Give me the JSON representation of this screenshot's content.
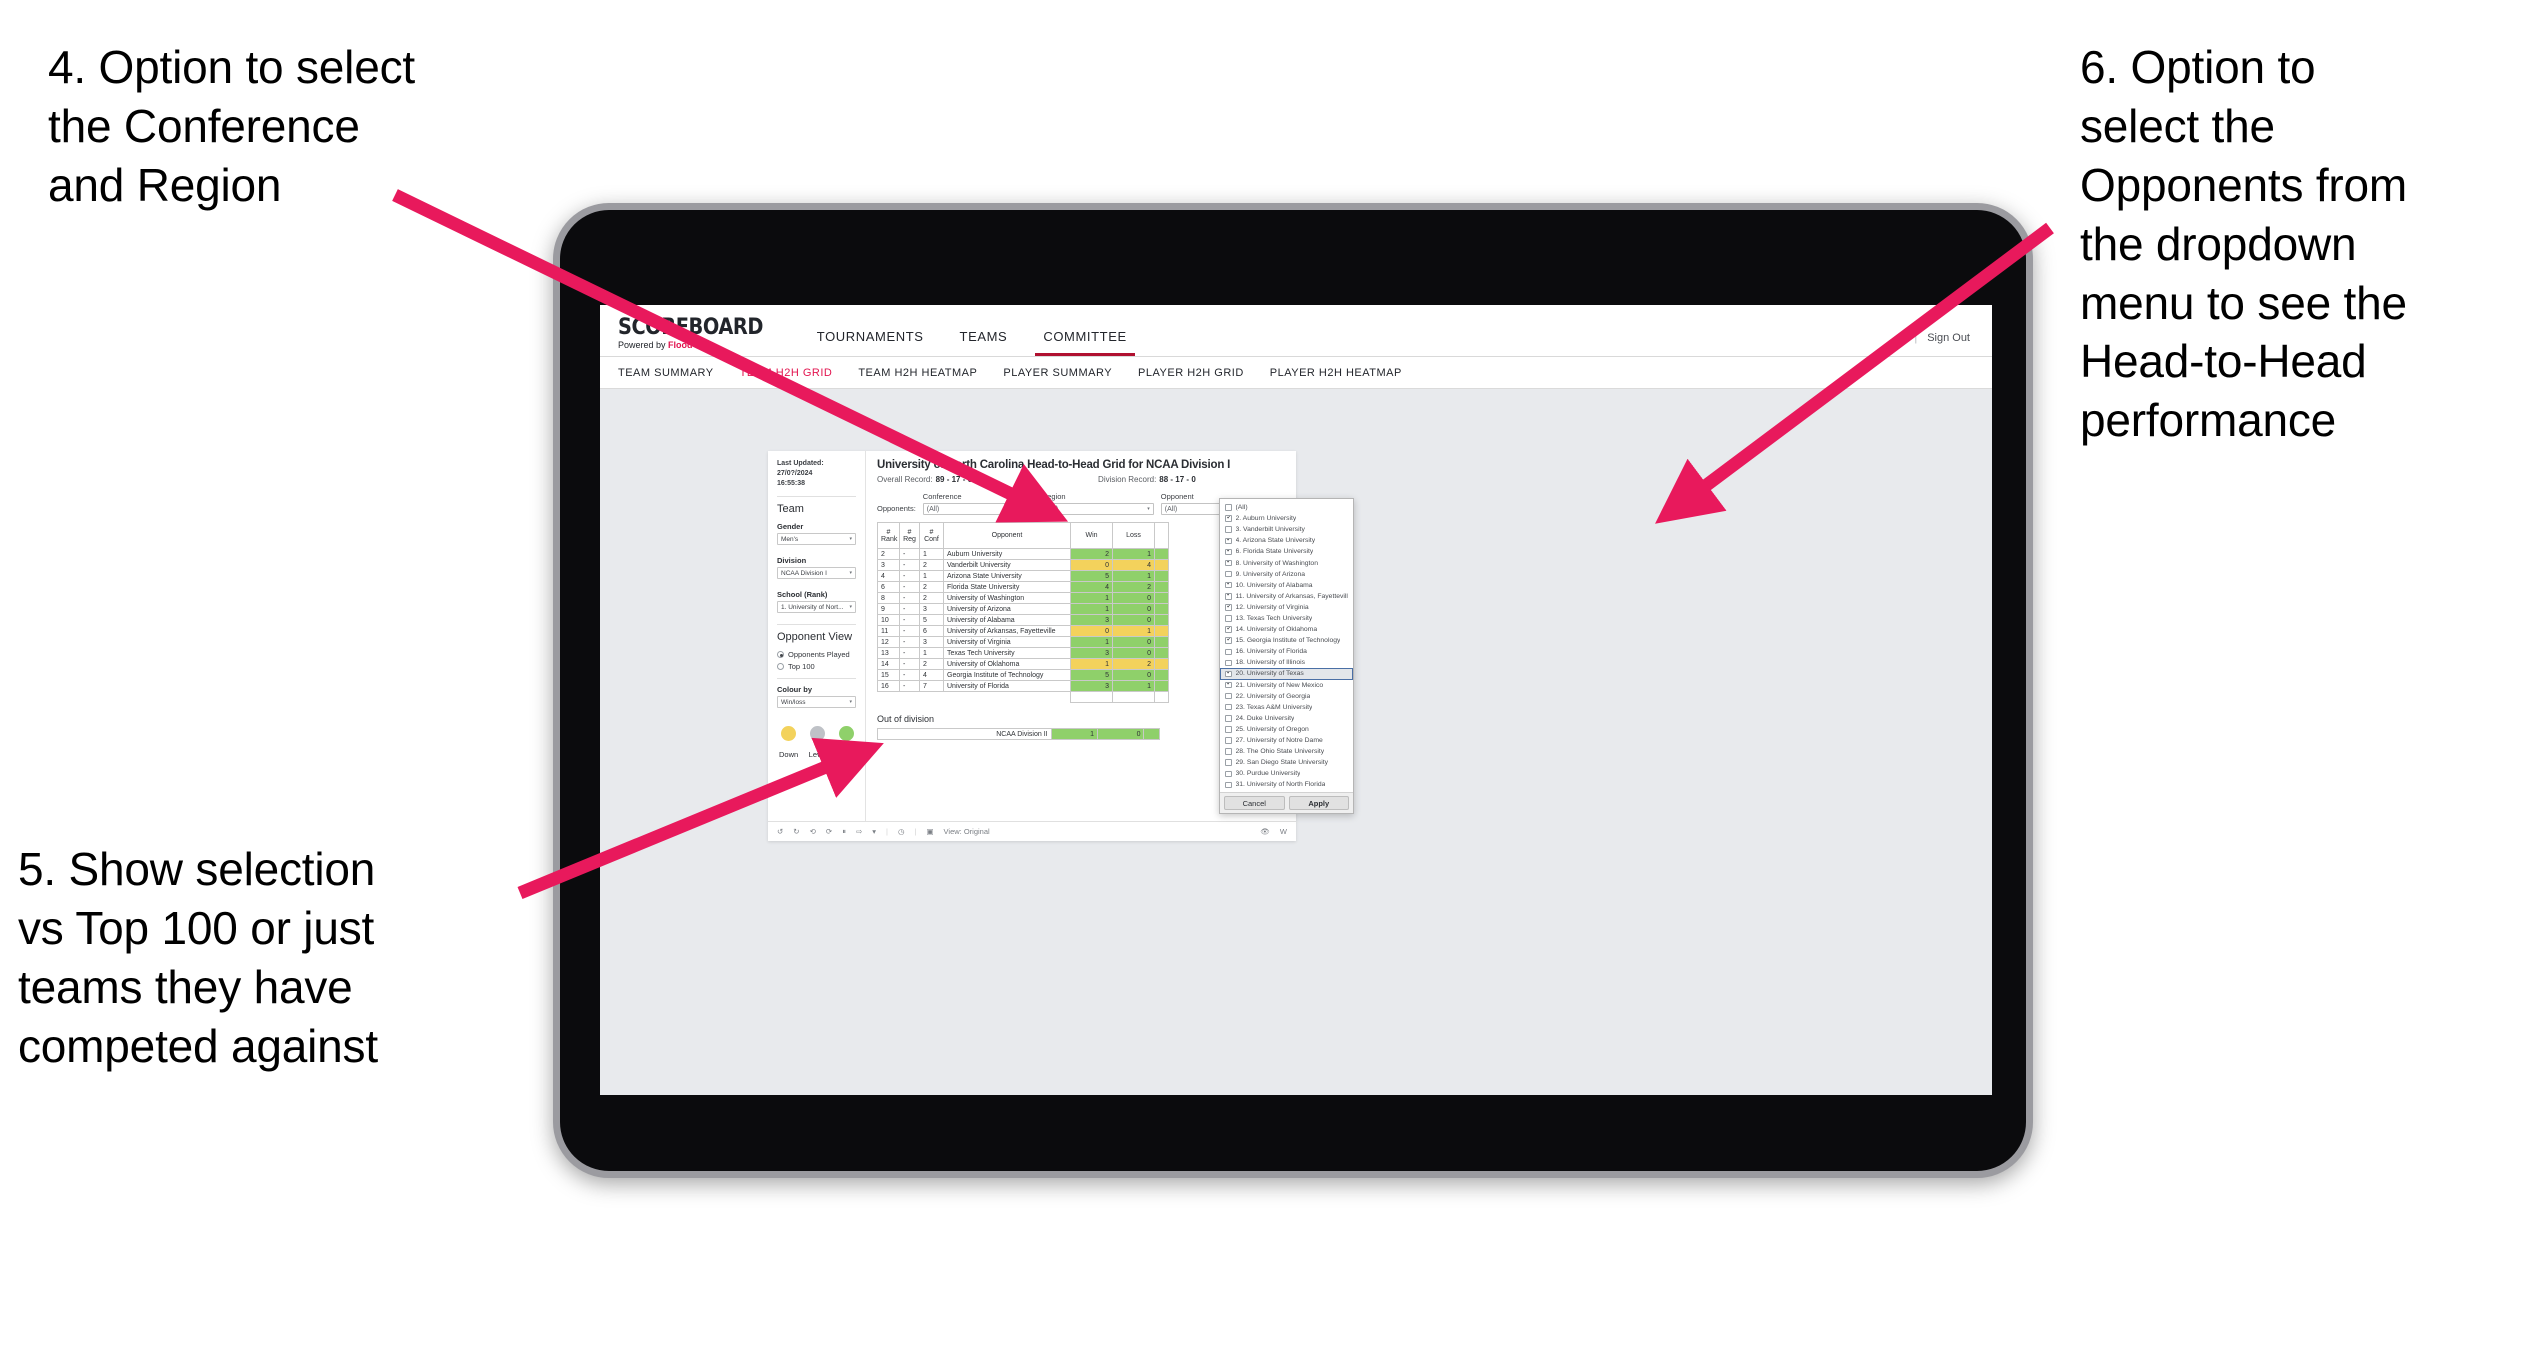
{
  "annotations": [
    {
      "id": "a4",
      "text": "4. Option to select\nthe Conference\nand Region"
    },
    {
      "id": "a5",
      "text": "5. Show selection\nvs Top 100 or just\nteams they have\ncompeted against"
    },
    {
      "id": "a6",
      "text": "6. Option to\nselect the\nOpponents from\nthe dropdown\nmenu to see the\nHead-to-Head\nperformance"
    }
  ],
  "accent_color": "#e8195c",
  "header": {
    "brand_name": "SCOREBOARD",
    "brand_sub_prefix": "Powered by ",
    "brand_sub_accent": "Flood",
    "nav": [
      {
        "label": "TOURNAMENTS",
        "active": false
      },
      {
        "label": "TEAMS",
        "active": false
      },
      {
        "label": "COMMITTEE",
        "active": true
      }
    ],
    "separator": "|",
    "sign_out": "Sign Out"
  },
  "subnav": [
    {
      "label": "TEAM SUMMARY",
      "active": false
    },
    {
      "label": "TEAM H2H GRID",
      "active": true
    },
    {
      "label": "TEAM H2H HEATMAP",
      "active": false
    },
    {
      "label": "PLAYER SUMMARY",
      "active": false
    },
    {
      "label": "PLAYER H2H GRID",
      "active": false
    },
    {
      "label": "PLAYER H2H HEATMAP",
      "active": false
    }
  ],
  "panel": {
    "updated_line1": "Last Updated: 27/0?/2024",
    "updated_line2": "16:55:38",
    "team_heading": "Team",
    "gender_label": "Gender",
    "gender_value": "Men's",
    "division_label": "Division",
    "division_value": "NCAA Division I",
    "school_label": "School (Rank)",
    "school_value": "1. University of Nort...",
    "opponent_view_heading": "Opponent View",
    "opponent_view_options": [
      {
        "label": "Opponents Played",
        "selected": true
      },
      {
        "label": "Top 100",
        "selected": false
      }
    ],
    "colour_by_label": "Colour by",
    "colour_by_value": "Win/loss",
    "legend": [
      {
        "label": "Down",
        "color": "#f3d25c"
      },
      {
        "label": "Level",
        "color": "#bfc2c7"
      },
      {
        "label": "Up",
        "color": "#8fd06a"
      }
    ]
  },
  "viz": {
    "title": "University of North Carolina Head-to-Head Grid for NCAA Division I",
    "overall_record_label": "Overall Record:",
    "overall_record_value": "89 - 17 - 0",
    "division_record_label": "Division Record:",
    "division_record_value": "88 - 17 - 0",
    "opponents_lead": "Opponents:",
    "filters": [
      {
        "label": "Conference",
        "value": "(All)"
      },
      {
        "label": "Region",
        "value": "(All)"
      },
      {
        "label": "Opponent",
        "value": "(All)"
      }
    ],
    "out_of_division_title": "Out of division",
    "out_of_division_row": {
      "label": "NCAA Division II",
      "win": "1",
      "loss": "0",
      "state": "up"
    }
  },
  "chart_data": {
    "type": "table",
    "title": "University of North Carolina Head-to-Head Grid for NCAA Division I",
    "columns": [
      "# Rank",
      "# Reg",
      "# Conf",
      "Opponent",
      "Win",
      "Loss"
    ],
    "column_headers_multiline": [
      {
        "l1": "#",
        "l2": "Rank"
      },
      {
        "l1": "#",
        "l2": "Reg"
      },
      {
        "l1": "#",
        "l2": "Conf"
      },
      {
        "l1": "",
        "l2": "Opponent"
      },
      {
        "l1": "",
        "l2": "Win"
      },
      {
        "l1": "",
        "l2": "Loss"
      }
    ],
    "color_legend": {
      "up": "#8fd06a",
      "down": "#f3d25c",
      "level": "#bfc2c7"
    },
    "rows": [
      {
        "rank": "2",
        "reg": "-",
        "conf": "1",
        "opponent": "Auburn University",
        "win": "2",
        "loss": "1",
        "state": "up"
      },
      {
        "rank": "3",
        "reg": "-",
        "conf": "2",
        "opponent": "Vanderbilt University",
        "win": "0",
        "loss": "4",
        "state": "down"
      },
      {
        "rank": "4",
        "reg": "-",
        "conf": "1",
        "opponent": "Arizona State University",
        "win": "5",
        "loss": "1",
        "state": "up"
      },
      {
        "rank": "6",
        "reg": "-",
        "conf": "2",
        "opponent": "Florida State University",
        "win": "4",
        "loss": "2",
        "state": "up"
      },
      {
        "rank": "8",
        "reg": "-",
        "conf": "2",
        "opponent": "University of Washington",
        "win": "1",
        "loss": "0",
        "state": "up"
      },
      {
        "rank": "9",
        "reg": "-",
        "conf": "3",
        "opponent": "University of Arizona",
        "win": "1",
        "loss": "0",
        "state": "up"
      },
      {
        "rank": "10",
        "reg": "-",
        "conf": "5",
        "opponent": "University of Alabama",
        "win": "3",
        "loss": "0",
        "state": "up"
      },
      {
        "rank": "11",
        "reg": "-",
        "conf": "6",
        "opponent": "University of Arkansas, Fayetteville",
        "win": "0",
        "loss": "1",
        "state": "down"
      },
      {
        "rank": "12",
        "reg": "-",
        "conf": "3",
        "opponent": "University of Virginia",
        "win": "1",
        "loss": "0",
        "state": "up"
      },
      {
        "rank": "13",
        "reg": "-",
        "conf": "1",
        "opponent": "Texas Tech University",
        "win": "3",
        "loss": "0",
        "state": "up"
      },
      {
        "rank": "14",
        "reg": "-",
        "conf": "2",
        "opponent": "University of Oklahoma",
        "win": "1",
        "loss": "2",
        "state": "down"
      },
      {
        "rank": "15",
        "reg": "-",
        "conf": "4",
        "opponent": "Georgia Institute of Technology",
        "win": "5",
        "loss": "0",
        "state": "up"
      },
      {
        "rank": "16",
        "reg": "-",
        "conf": "7",
        "opponent": "University of Florida",
        "win": "3",
        "loss": "1",
        "state": "up"
      }
    ]
  },
  "opponent_dropdown": {
    "items": [
      {
        "label": "(All)",
        "checked": false,
        "highlighted": false
      },
      {
        "label": "2. Auburn University",
        "checked": true,
        "highlighted": false
      },
      {
        "label": "3. Vanderbilt University",
        "checked": false,
        "highlighted": false
      },
      {
        "label": "4. Arizona State University",
        "checked": true,
        "highlighted": false
      },
      {
        "label": "6. Florida State University",
        "checked": true,
        "highlighted": false
      },
      {
        "label": "8. University of Washington",
        "checked": true,
        "highlighted": false
      },
      {
        "label": "9. University of Arizona",
        "checked": false,
        "highlighted": false
      },
      {
        "label": "10. University of Alabama",
        "checked": true,
        "highlighted": false
      },
      {
        "label": "11. University of Arkansas, Fayetteville",
        "checked": true,
        "highlighted": false
      },
      {
        "label": "12. University of Virginia",
        "checked": true,
        "highlighted": false
      },
      {
        "label": "13. Texas Tech University",
        "checked": false,
        "highlighted": false
      },
      {
        "label": "14. University of Oklahoma",
        "checked": true,
        "highlighted": false
      },
      {
        "label": "15. Georgia Institute of Technology",
        "checked": true,
        "highlighted": false
      },
      {
        "label": "16. University of Florida",
        "checked": false,
        "highlighted": false
      },
      {
        "label": "18. University of Illinois",
        "checked": false,
        "highlighted": false
      },
      {
        "label": "20. University of Texas",
        "checked": true,
        "highlighted": true
      },
      {
        "label": "21. University of New Mexico",
        "checked": true,
        "highlighted": false
      },
      {
        "label": "22. University of Georgia",
        "checked": false,
        "highlighted": false
      },
      {
        "label": "23. Texas A&M University",
        "checked": false,
        "highlighted": false
      },
      {
        "label": "24. Duke University",
        "checked": false,
        "highlighted": false
      },
      {
        "label": "25. University of Oregon",
        "checked": false,
        "highlighted": false
      },
      {
        "label": "27. University of Notre Dame",
        "checked": false,
        "highlighted": false
      },
      {
        "label": "28. The Ohio State University",
        "checked": false,
        "highlighted": false
      },
      {
        "label": "29. San Diego State University",
        "checked": false,
        "highlighted": false
      },
      {
        "label": "30. Purdue University",
        "checked": false,
        "highlighted": false
      },
      {
        "label": "31. University of North Florida",
        "checked": false,
        "highlighted": false
      }
    ],
    "cancel_label": "Cancel",
    "apply_label": "Apply"
  },
  "toolbar": {
    "view_label": "View: Original",
    "watch_label": "W"
  }
}
